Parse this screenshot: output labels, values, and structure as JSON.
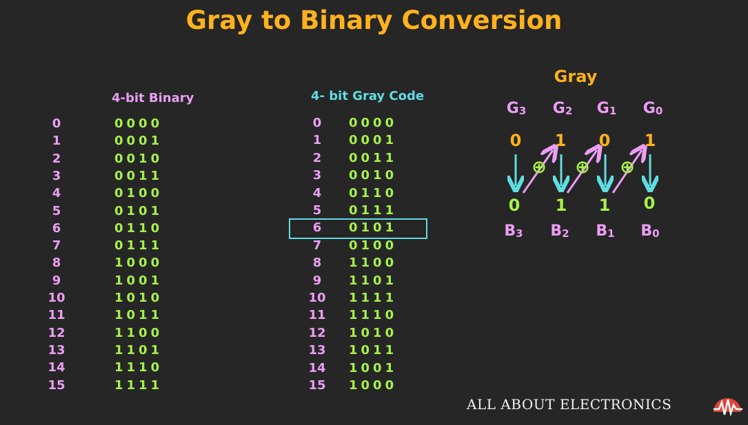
{
  "title": "Gray to Binary Conversion",
  "table_binary": {
    "header": "4-bit Binary",
    "rows": [
      {
        "dec": "0",
        "code": "0000"
      },
      {
        "dec": "1",
        "code": "0001"
      },
      {
        "dec": "2",
        "code": "0010"
      },
      {
        "dec": "3",
        "code": "0011"
      },
      {
        "dec": "4",
        "code": "0100"
      },
      {
        "dec": "5",
        "code": "0101"
      },
      {
        "dec": "6",
        "code": "0110"
      },
      {
        "dec": "7",
        "code": "0111"
      },
      {
        "dec": "8",
        "code": "1000"
      },
      {
        "dec": "9",
        "code": "1001"
      },
      {
        "dec": "10",
        "code": "1010"
      },
      {
        "dec": "11",
        "code": "1011"
      },
      {
        "dec": "12",
        "code": "1100"
      },
      {
        "dec": "13",
        "code": "1101"
      },
      {
        "dec": "14",
        "code": "1110"
      },
      {
        "dec": "15",
        "code": "1111"
      }
    ]
  },
  "table_gray": {
    "header": "4- bit Gray Code",
    "highlighted_row": "6",
    "rows": [
      {
        "dec": "0",
        "code": "0000"
      },
      {
        "dec": "1",
        "code": "0001"
      },
      {
        "dec": "2",
        "code": "0011"
      },
      {
        "dec": "3",
        "code": "0010"
      },
      {
        "dec": "4",
        "code": "0110"
      },
      {
        "dec": "5",
        "code": "0111"
      },
      {
        "dec": "6",
        "code": "0101"
      },
      {
        "dec": "7",
        "code": "0100"
      },
      {
        "dec": "8",
        "code": "1100"
      },
      {
        "dec": "9",
        "code": "1101"
      },
      {
        "dec": "10",
        "code": "1111"
      },
      {
        "dec": "11",
        "code": "1110"
      },
      {
        "dec": "12",
        "code": "1010"
      },
      {
        "dec": "13",
        "code": "1011"
      },
      {
        "dec": "14",
        "code": "1001"
      },
      {
        "dec": "15",
        "code": "1000"
      }
    ]
  },
  "conversion": {
    "title": "Gray",
    "gray_labels": [
      {
        "letter": "G",
        "sub": "3"
      },
      {
        "letter": "G",
        "sub": "2"
      },
      {
        "letter": "G",
        "sub": "1"
      },
      {
        "letter": "G",
        "sub": "0"
      }
    ],
    "gray_bits": [
      "0",
      "1",
      "0",
      "1"
    ],
    "xor_symbol": "⊕",
    "binary_bits": [
      "0",
      "1",
      "1",
      "0"
    ],
    "binary_labels": [
      {
        "letter": "B",
        "sub": "3"
      },
      {
        "letter": "B",
        "sub": "2"
      },
      {
        "letter": "B",
        "sub": "1"
      },
      {
        "letter": "B",
        "sub": "0"
      }
    ]
  },
  "footer": "ALL ABOUT ELECTRONICS",
  "colors": {
    "background": "#262626",
    "title": "#ffb21e",
    "decimal": "#ec9ef5",
    "code": "#a6f14a",
    "gray_header": "#5fdde3",
    "arrow": "#5fdde3",
    "diag_arrow": "#ec9ef5"
  },
  "icons": {
    "logo": "waveform-logo-icon"
  }
}
